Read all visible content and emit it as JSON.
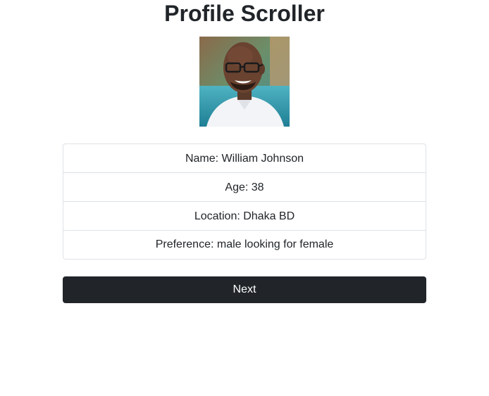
{
  "page": {
    "title": "Profile Scroller"
  },
  "profile": {
    "photo_alt": "profile-photo",
    "fields": [
      {
        "text": "Name: William Johnson"
      },
      {
        "text": "Age: 38"
      },
      {
        "text": "Location: Dhaka BD"
      },
      {
        "text": "Preference: male looking for female"
      }
    ]
  },
  "actions": {
    "next_label": "Next"
  },
  "colors": {
    "button_bg": "#212529",
    "border": "#dee2e6",
    "text": "#212529"
  }
}
